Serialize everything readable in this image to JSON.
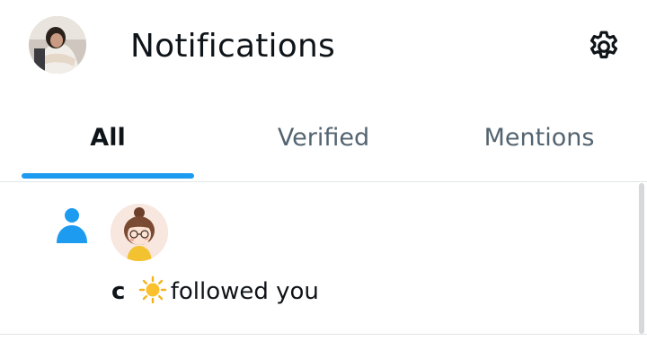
{
  "header": {
    "title": "Notifications",
    "avatar_icon": "user-avatar-photo",
    "settings_icon": "gear-icon"
  },
  "tabs": [
    {
      "label": "All",
      "active": true
    },
    {
      "label": "Verified",
      "active": false
    },
    {
      "label": "Mentions",
      "active": false
    }
  ],
  "colors": {
    "accent": "#1d9bf0",
    "text_primary": "#0f1419",
    "text_secondary": "#536471",
    "divider": "#e2e6e9"
  },
  "notifications": [
    {
      "type_icon": "person-icon",
      "user_name": "c",
      "user_emoji_icon": "sun-icon",
      "action": "followed you"
    }
  ]
}
